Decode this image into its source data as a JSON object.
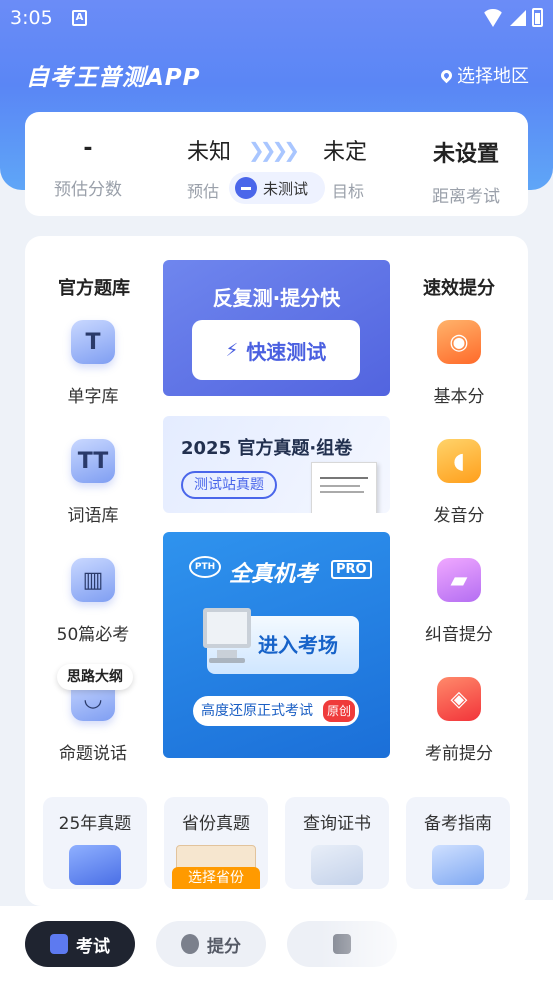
{
  "status": {
    "time": "3:05",
    "notif_icon": "A"
  },
  "header": {
    "title": "自考王普测APP",
    "region_label": "选择地区"
  },
  "score_card": {
    "estimate_value": "-",
    "estimate_label": "预估分数",
    "unknown": "未知",
    "pending": "未定",
    "estimate_small": "预估",
    "target_small": "目标",
    "untested": "未测试",
    "exam_value": "未设置",
    "exam_label": "距离考试"
  },
  "left_col": {
    "heading": "官方题库",
    "items": [
      {
        "label": "单字库",
        "glyph": "T"
      },
      {
        "label": "词语库",
        "glyph": "TT"
      },
      {
        "label": "50篇必考",
        "glyph": "▥"
      },
      {
        "label": "命题说话",
        "glyph": "◡"
      }
    ],
    "bubble": "思路大纲"
  },
  "right_col": {
    "heading": "速效提分",
    "items": [
      {
        "label": "基本分"
      },
      {
        "label": "发音分"
      },
      {
        "label": "纠音提分"
      },
      {
        "label": "考前提分"
      }
    ]
  },
  "banner_quick": {
    "title": "反复测·提分快",
    "button": "快速测试"
  },
  "banner_official": {
    "title": "2025 官方真题·组卷",
    "tag": "测试站真题"
  },
  "banner_exam": {
    "logo": "PTH",
    "title": "全真机考",
    "pro": "PRO",
    "button": "进入考场",
    "subtitle": "高度还原正式考试",
    "orig": "原创"
  },
  "mini_cards": [
    {
      "label": "25年真题"
    },
    {
      "label": "省份真题",
      "badge": "选择省份"
    },
    {
      "label": "查询证书"
    },
    {
      "label": "备考指南"
    }
  ],
  "bottom_nav": [
    {
      "label": "考试"
    },
    {
      "label": "提分"
    }
  ],
  "colors": {
    "brand_blue": "#4a66ea",
    "active_tab": "#1f2430",
    "province_badge": "#ff9a00",
    "orig_tag": "#ef3b3b"
  }
}
